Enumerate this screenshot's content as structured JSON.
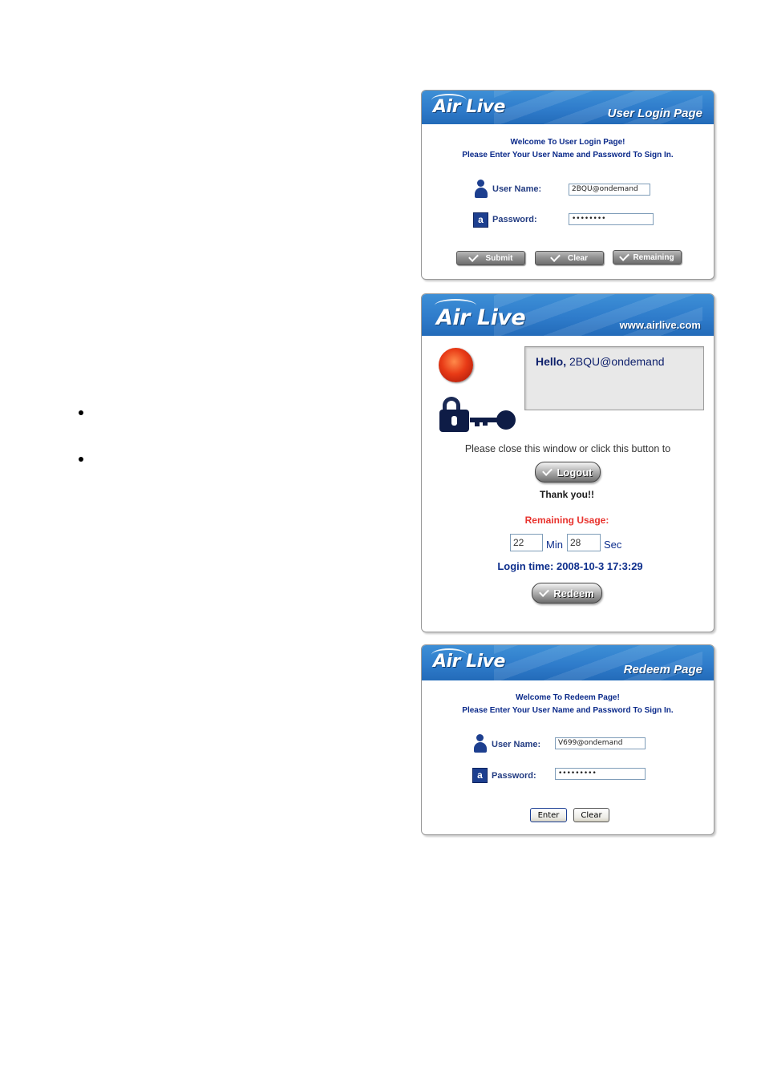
{
  "login": {
    "logo": "Air Live",
    "title": "User Login Page",
    "welcome_line1": "Welcome To User Login Page!",
    "welcome_line2": "Please Enter Your User Name and Password To Sign In.",
    "username_label": "User Name:",
    "username_value": "2BQU@ondemand",
    "password_label": "Password:",
    "password_value": "••••••••",
    "submit_label": "Submit",
    "clear_label": "Clear",
    "remaining_label": "Remaining"
  },
  "status": {
    "logo": "Air Live",
    "url": "www.airlive.com",
    "hello_label": "Hello,",
    "hello_user": "2BQU@ondemand",
    "close_text": "Please close this window or click this button to",
    "logout_label": "Logout",
    "thanks": "Thank you!!",
    "remaining_title": "Remaining Usage:",
    "minutes": "22",
    "min_unit": "Min",
    "seconds": "28",
    "sec_unit": "Sec",
    "login_time": "Login time: 2008-10-3 17:3:29",
    "redeem_label": "Redeem"
  },
  "redeem": {
    "logo": "Air Live",
    "title": "Redeem Page",
    "welcome_line1": "Welcome To Redeem Page!",
    "welcome_line2": "Please Enter Your User Name and Password To Sign In.",
    "username_label": "User Name:",
    "username_value": "V699@ondemand",
    "password_label": "Password:",
    "password_value": "•••••••••",
    "enter_label": "Enter",
    "clear_label": "Clear"
  },
  "colors": {
    "banner_blue": "#2f7ccb",
    "label_navy": "#233c82",
    "remaining_red": "#e8322d"
  }
}
